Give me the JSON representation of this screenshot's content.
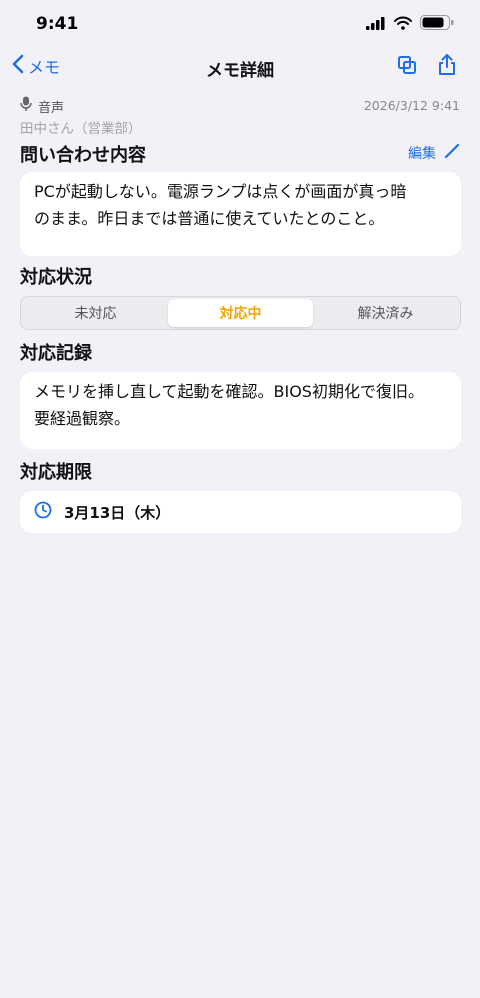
{
  "status_bar": {
    "time": "9:41"
  },
  "nav": {
    "back_label": "メモ",
    "title": "メモ詳細"
  },
  "meta": {
    "source_type": "音声",
    "requester": "田中さん（営業部）",
    "date": "2026/3/12 9:41"
  },
  "inquiry": {
    "heading": "問い合わせ内容",
    "edit_label": "編集",
    "line1": "PCが起動しない。電源ランプは点くが画面が真っ暗",
    "line2": "のまま。昨日までは普通に使えていたとのこと。"
  },
  "status": {
    "heading": "対応状況",
    "options": [
      "未対応",
      "対応中",
      "解決済み"
    ],
    "selected": "対応中"
  },
  "record": {
    "heading": "対応記録",
    "line1": "メモリを挿し直して起動を確認。BIOS初期化で復旧。",
    "line2": "要経過観察。"
  },
  "due": {
    "heading": "対応期限",
    "value": "3月13日（木）"
  },
  "colors": {
    "accent": "#1f6fe5",
    "in_progress": "#f0a500",
    "background": "#f2f1f7"
  }
}
